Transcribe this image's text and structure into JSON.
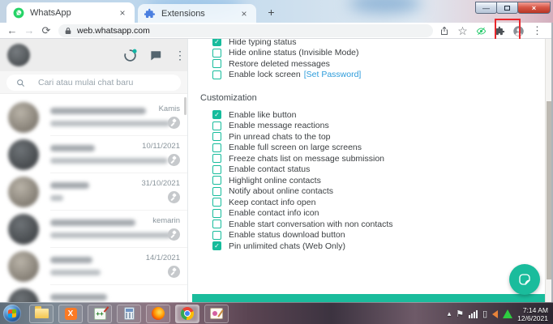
{
  "window": {
    "tabs": [
      {
        "label": "WhatsApp",
        "icon": "whatsapp-icon"
      },
      {
        "label": "Extensions",
        "icon": "puzzle-icon"
      }
    ],
    "glyphs": {
      "tab_close": "×",
      "new_tab": "+",
      "back": "←",
      "forward": "→",
      "reload": "⟳",
      "star": "☆",
      "menu_dots": "⋮",
      "minimize": "—",
      "close": "×",
      "tray_expand": "▴",
      "tray_flag": "⚑",
      "check": "✓"
    }
  },
  "toolbar": {
    "url": "web.whatsapp.com"
  },
  "sidebar": {
    "search_placeholder": "Cari atau mulai chat baru",
    "chats": [
      {
        "time": "Kamis",
        "pinned": true,
        "redacted": true
      },
      {
        "time": "10/11/2021",
        "pinned": true,
        "redacted": true
      },
      {
        "time": "31/10/2021",
        "pinned": true,
        "redacted": true
      },
      {
        "time": "kemarin",
        "pinned": true,
        "redacted": true
      },
      {
        "time": "14/1/2021",
        "pinned": true,
        "redacted": true
      },
      {
        "time": "",
        "pinned": false,
        "redacted": true
      }
    ]
  },
  "settings": {
    "privacy_items": [
      {
        "label": "Hide typing status",
        "checked": true
      },
      {
        "label": "Hide online status (Invisible Mode)",
        "checked": false
      },
      {
        "label": "Restore deleted messages",
        "checked": false
      },
      {
        "label": "Enable lock screen",
        "link": "[Set Password]",
        "checked": false
      }
    ],
    "section_title": "Customization",
    "customization_items": [
      {
        "label": "Enable like button",
        "checked": true
      },
      {
        "label": "Enable message reactions",
        "checked": false
      },
      {
        "label": "Pin unread chats to the top",
        "checked": false
      },
      {
        "label": "Enable full screen on large screens",
        "checked": false
      },
      {
        "label": "Freeze chats list on message submission",
        "checked": false
      },
      {
        "label": "Enable contact status",
        "checked": false
      },
      {
        "label": "Highlight online contacts",
        "checked": false
      },
      {
        "label": "Notify about online contacts",
        "checked": false
      },
      {
        "label": "Keep contact info open",
        "checked": false
      },
      {
        "label": "Enable contact info icon",
        "checked": false
      },
      {
        "label": "Enable start conversation with non contacts",
        "checked": false
      },
      {
        "label": "Enable status download button",
        "checked": false
      },
      {
        "label": "Pin unlimited chats (Web Only)",
        "checked": true
      }
    ],
    "accent_color": "#1abc9c",
    "link_color": "#2d9cdb",
    "highlight_box_color": "#e8272c"
  },
  "taskbar": {
    "apps": [
      "start",
      "explorer",
      "xampp",
      "dev-cpp",
      "calculator",
      "firefox",
      "chrome",
      "paint"
    ],
    "active_app": "chrome",
    "tray": {
      "time": "7:14 AM",
      "date": "12/6/2021"
    }
  }
}
